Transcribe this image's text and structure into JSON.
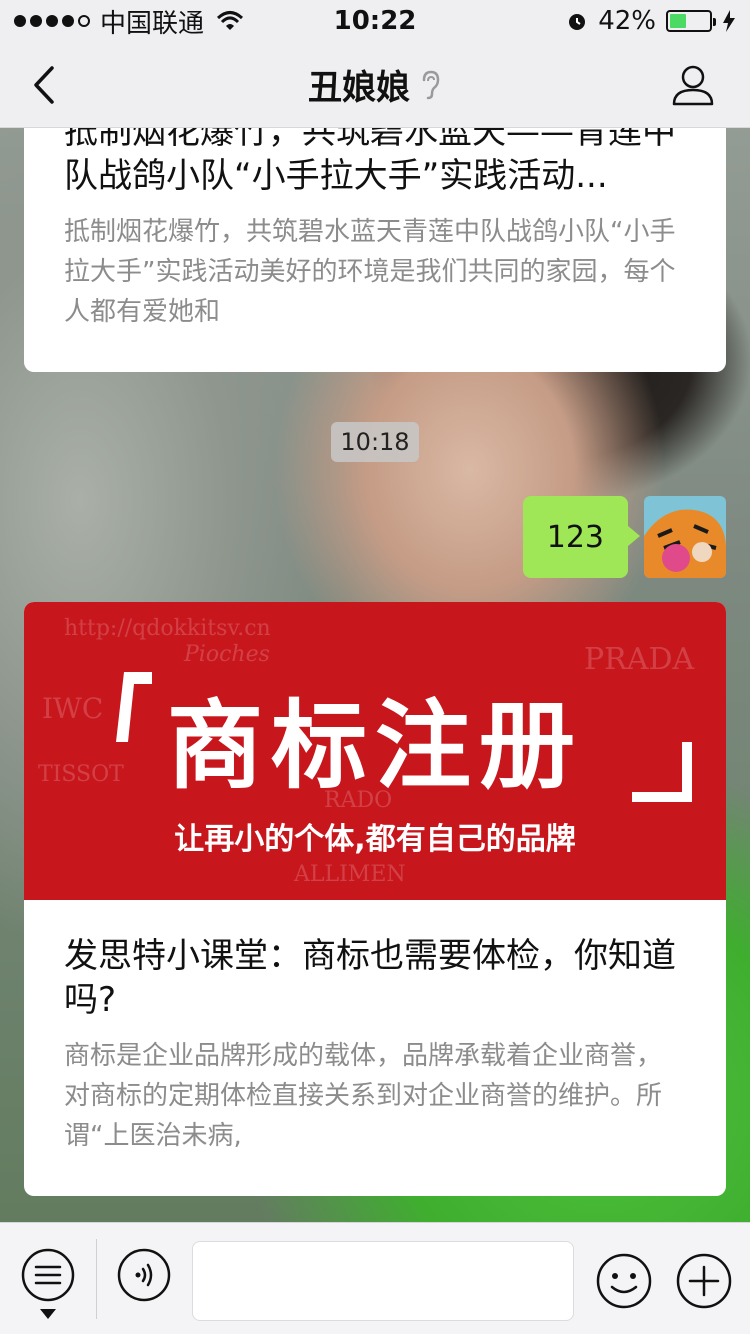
{
  "status_bar": {
    "carrier": "中国联通",
    "time": "10:22",
    "battery": "42%",
    "battery_level": 0.42
  },
  "nav": {
    "title": "丑娘娘"
  },
  "messages": {
    "card1": {
      "title": "抵制烟花爆竹，共筑碧水蓝天——青莲中队战鸽小队“小手拉大手”实践活动...",
      "desc": "抵制烟花爆竹，共筑碧水蓝天青莲中队战鸽小队“小手拉大手”实践活动美好的环境是我们共同的家园，每个人都有爱她和"
    },
    "timestamp": "10:18",
    "bubble_text": "123",
    "card2": {
      "banner_title": "商标注册",
      "banner_subtitle": "让再小的个体,都有自己的品牌",
      "banner_watermarks": [
        "http://qdokkitsv.cn",
        "PRADA",
        "IWC",
        "TISSOT",
        "RADO",
        "Pioches",
        "ALLIMEN"
      ],
      "title": "发思特小课堂：商标也需要体检，你知道吗?",
      "desc": "商标是企业品牌形成的载体，品牌承载着企业商誉，对商标的定期体检直接关系到对企业商誉的维护。所谓“上医治未病,"
    }
  },
  "bottom_bar": {
    "input_value": ""
  },
  "colors": {
    "bubble": "#9fe756",
    "banner": "#c8161d",
    "bar_bg": "#efeff2"
  },
  "icons": [
    "back-arrow-icon",
    "ear-icon",
    "profile-icon",
    "menu-icon",
    "voice-icon",
    "emoji-icon",
    "plus-icon",
    "wifi-icon",
    "alarm-icon",
    "charging-icon"
  ]
}
